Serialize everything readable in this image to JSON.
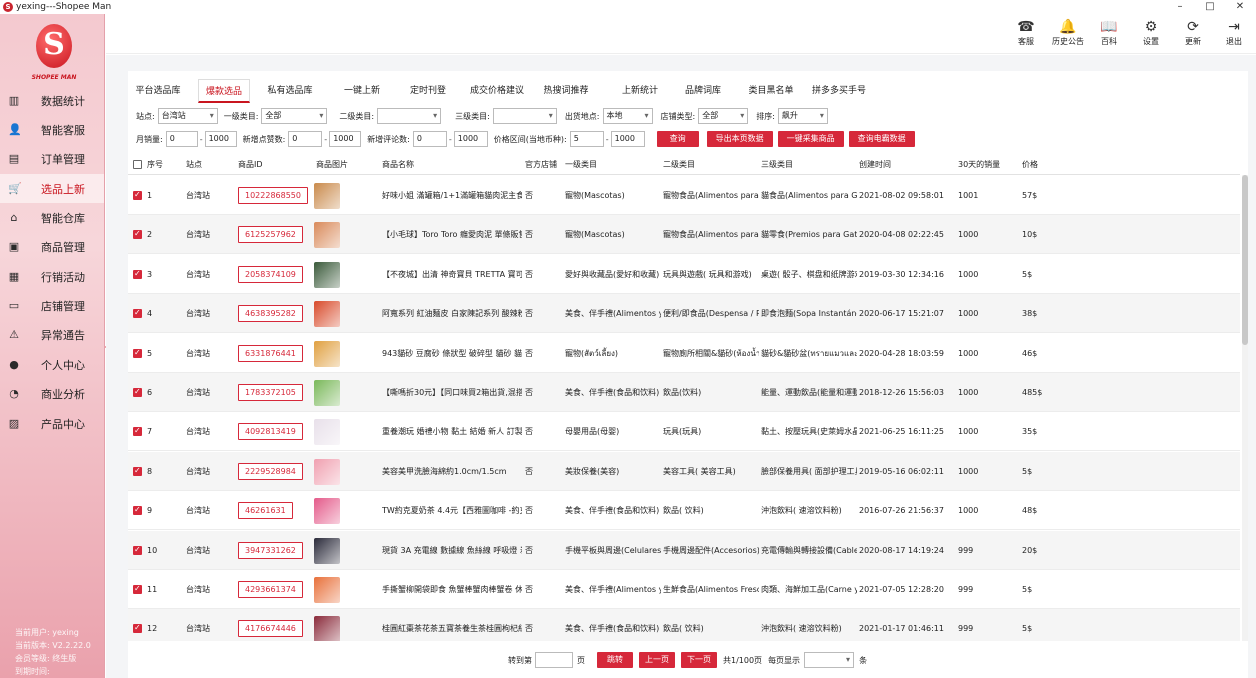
{
  "window": {
    "title": "yexing---Shopee Man",
    "icon": "S",
    "controls": [
      "–",
      "□",
      "✕"
    ]
  },
  "sidebar": {
    "logo_letter": "S",
    "logo_text": "SHOPEE MAN",
    "items": [
      {
        "label": "数据统计",
        "icon": "▥",
        "icon_name": "monitor-icon"
      },
      {
        "label": "智能客服",
        "icon": "👤",
        "icon_name": "customer-service-icon"
      },
      {
        "label": "订单管理",
        "icon": "▤",
        "icon_name": "order-icon"
      },
      {
        "label": "选品上新",
        "icon": "🛒",
        "icon_name": "cart-icon"
      },
      {
        "label": "智能仓库",
        "icon": "⌂",
        "icon_name": "warehouse-icon"
      },
      {
        "label": "商品管理",
        "icon": "▣",
        "icon_name": "product-icon"
      },
      {
        "label": "行销活动",
        "icon": "▦",
        "icon_name": "marketing-icon"
      },
      {
        "label": "店铺管理",
        "icon": "▭",
        "icon_name": "store-icon"
      },
      {
        "label": "异常通告",
        "icon": "⚠",
        "icon_name": "alert-icon"
      },
      {
        "label": "个人中心",
        "icon": "●",
        "icon_name": "person-icon"
      },
      {
        "label": "商业分析",
        "icon": "◔",
        "icon_name": "analysis-icon"
      },
      {
        "label": "产品中心",
        "icon": "▨",
        "icon_name": "product-center-icon"
      }
    ],
    "user_lines": [
      "当前用户:  yexing",
      "当前版本:  V2.2.22.0",
      "会员等级:  终生版",
      "到期时间:"
    ]
  },
  "topbar": [
    {
      "label": "客服",
      "icon": "☎",
      "icon_name": "headset-icon"
    },
    {
      "label": "历史公告",
      "icon": "🔔",
      "icon_name": "bell-icon"
    },
    {
      "label": "百科",
      "icon": "📖",
      "icon_name": "book-icon"
    },
    {
      "label": "设置",
      "icon": "⚙",
      "icon_name": "gear-icon"
    },
    {
      "label": "更新",
      "icon": "⟳",
      "icon_name": "refresh-icon"
    },
    {
      "label": "退出",
      "icon": "⇥",
      "icon_name": "logout-icon"
    }
  ],
  "tabs": [
    "平台选品库",
    "爆款选品",
    "私有选品库",
    "一键上新",
    "定时刊登",
    "成交价格建议",
    "热搜词推荐",
    "上新统计",
    "品牌词库",
    "类目黑名单",
    "拼多多买手号"
  ],
  "active_tab": "爆款选品",
  "filters": {
    "site_label": "站点:",
    "site_value": "台湾站",
    "cat1_label": "一级类目:",
    "cat1_value": "全部",
    "cat2_label": "二级类目:",
    "cat2_value": "",
    "cat3_label": "三级类目:",
    "cat3_value": "",
    "ship_label": "出货地点:",
    "ship_value": "本地",
    "storetype_label": "店铺类型:",
    "storetype_value": "全部",
    "sort_label": "排序:",
    "sort_value": "飙升",
    "monthly_label": "月销量:",
    "monthly_min": "0",
    "monthly_max": "1000",
    "likes_label": "新增点赞数:",
    "likes_min": "0",
    "likes_max": "1000",
    "reviews_label": "新增评论数:",
    "reviews_min": "0",
    "reviews_max": "1000",
    "price_label": "价格区间(当地币种):",
    "price_min": "5",
    "price_max": "1000",
    "dash": "-"
  },
  "actions": [
    "查询",
    "导出本页数据",
    "一键采集商品",
    "查询电霸数据"
  ],
  "columns": [
    "序号",
    "站点",
    "商品ID",
    "商品图片",
    "商品名称",
    "官方店铺",
    "一级类目",
    "二级类目",
    "三级类目",
    "创建时间",
    "30天的销量",
    "价格"
  ],
  "rows": [
    {
      "idx": "1",
      "site": "台湾站",
      "id": "10222868550",
      "name": "好味小姐 滿罐箱/1+1滿罐箱貓肉泥主食",
      "official": "否",
      "cat1": "寵物(Mascotas)",
      "cat2": "寵物食品(Alimentos para M",
      "cat3": "貓食品(Alimentos para Ga",
      "created": "2021-08-02 09:58:01",
      "sales": "1001",
      "price": "57$",
      "img": "#c98a4b"
    },
    {
      "idx": "2",
      "site": "台湾站",
      "id": "6125257962",
      "name": "【小毛球】Toro Toro 癮愛肉泥 單條販售",
      "official": "否",
      "cat1": "寵物(Mascotas)",
      "cat2": "寵物食品(Alimentos para M",
      "cat3": "貓零食(Premios para Gato",
      "created": "2020-04-08 02:22:45",
      "sales": "1000",
      "price": "10$",
      "img": "#d98a5a"
    },
    {
      "idx": "3",
      "site": "台湾站",
      "id": "2058374109",
      "name": "【不夜城】出清 神奇寶貝 TRETTA 寶可夢",
      "official": "否",
      "cat1": "愛好與收藏品(愛好和收藏)",
      "cat2": "玩具與遊戲( 玩具和游戏)",
      "cat3": "桌遊( 骰子、棋盘和纸牌游戏",
      "created": "2019-03-30 12:34:16",
      "sales": "1000",
      "price": "5$",
      "img": "#3a5a3a"
    },
    {
      "idx": "4",
      "site": "台湾站",
      "id": "4638395282",
      "name": "阿寬系列 紅油麵皮 白家陳記系列 酸辣粉",
      "official": "否",
      "cat1": "美食、伴手禮(Alimentos y",
      "cat2": "便利/即食品(Despensa / P",
      "cat3": "即食泡麵(Sopa Instantáne",
      "created": "2020-06-17 15:21:07",
      "sales": "1000",
      "price": "38$",
      "img": "#d84a2a"
    },
    {
      "idx": "5",
      "site": "台湾站",
      "id": "6331876441",
      "name": "943貓砂 豆腐砂 條狀型 破碎型 貓砂 貓沙 1",
      "official": "否",
      "cat1": "寵物(สัตว์เลี้ยง)",
      "cat2": "寵物廁所相關&貓砂(ห้องน้ำ",
      "cat3": "貓砂&貓砂盆(ทรายแมวและกร",
      "created": "2020-04-28 18:03:59",
      "sales": "1000",
      "price": "46$",
      "img": "#e0a040"
    },
    {
      "idx": "6",
      "site": "台湾站",
      "id": "1783372105",
      "name": "【嘶嗎折30元】【同口味買2箱出貨,混搭",
      "official": "否",
      "cat1": "美食、伴手禮(食品和饮料)",
      "cat2": "飲品(饮料)",
      "cat3": "能量、運動飲品(能量和運動",
      "created": "2018-12-26 15:56:03",
      "sales": "1000",
      "price": "485$",
      "img": "#7ab85a"
    },
    {
      "idx": "7",
      "site": "台湾站",
      "id": "4092813419",
      "name": "重養潮玩 婚禮小物 黏土 結婚 新人 訂製",
      "official": "否",
      "cat1": "母嬰用品(母婴)",
      "cat2": "玩具(玩具)",
      "cat3": "黏土、按壓玩具(史萊姆水晶",
      "created": "2021-06-25 16:11:25",
      "sales": "1000",
      "price": "35$",
      "img": "#e8e0ea"
    },
    {
      "idx": "8",
      "site": "台湾站",
      "id": "2229528984",
      "name": "美容美甲洗臉海綿約1.0cm/1.5cm",
      "official": "否",
      "cat1": "美妝保養(美容)",
      "cat2": "美容工具( 美容工具)",
      "cat3": "臉部保養用具( 面部护理工具",
      "created": "2019-05-16 06:02:11",
      "sales": "1000",
      "price": "5$",
      "img": "#f0a0b0"
    },
    {
      "idx": "9",
      "site": "台湾站",
      "id": "46261631",
      "name": "TW約克夏奶茶 4.4元【西雅圖咖啡 -約克夏",
      "official": "否",
      "cat1": "美食、伴手禮(食品和饮料)",
      "cat2": "飲品( 饮料)",
      "cat3": "沖泡飲料( 速溶饮料粉)",
      "created": "2016-07-26 21:56:37",
      "sales": "1000",
      "price": "48$",
      "img": "#e45a8a"
    },
    {
      "idx": "10",
      "site": "台湾站",
      "id": "3947331262",
      "name": "現貨 3A 充電線 數據線 魚絲線 呼吸燈 炭",
      "official": "否",
      "cat1": "手機平板與周邊(Celulares",
      "cat2": "手機周邊配件(Accesorios)",
      "cat3": "充電傳輸與轉接設備(Cable",
      "created": "2020-08-17 14:19:24",
      "sales": "999",
      "price": "20$",
      "img": "#2a2a3a"
    },
    {
      "idx": "11",
      "site": "台湾站",
      "id": "4293661374",
      "name": "手撕蟹柳開袋即食 魚蟹棒蟹肉棒蟹卷 休閒",
      "official": "否",
      "cat1": "美食、伴手禮(Alimentos y",
      "cat2": "生鮮食品(Alimentos Fresco",
      "cat3": "肉類、海鮮加工品(Carne y",
      "created": "2021-07-05 12:28:20",
      "sales": "999",
      "price": "5$",
      "img": "#e8703a"
    },
    {
      "idx": "12",
      "site": "台湾站",
      "id": "4176674446",
      "name": "桂圓紅棗茶花茶五寶茶養生茶桂圓枸杞紅",
      "official": "否",
      "cat1": "美食、伴手禮(食品和饮料)",
      "cat2": "飲品( 饮料)",
      "cat3": "沖泡飲料( 速溶饮料粉)",
      "created": "2021-01-17 01:46:11",
      "sales": "999",
      "price": "5$",
      "img": "#8a2a3a"
    }
  ],
  "pager": {
    "goto_label": "转到第",
    "goto_value": "",
    "page_unit": "页",
    "jump": "跳转",
    "prev": "上一页",
    "next": "下一页",
    "summary": "共1/100页",
    "per_page_label": "每页显示",
    "per_page_value": "",
    "unit": "条"
  },
  "colors": {
    "accent": "#d6283a",
    "sidebar_top": "#f4c9cf",
    "sidebar_bottom": "#eaa1ac"
  }
}
